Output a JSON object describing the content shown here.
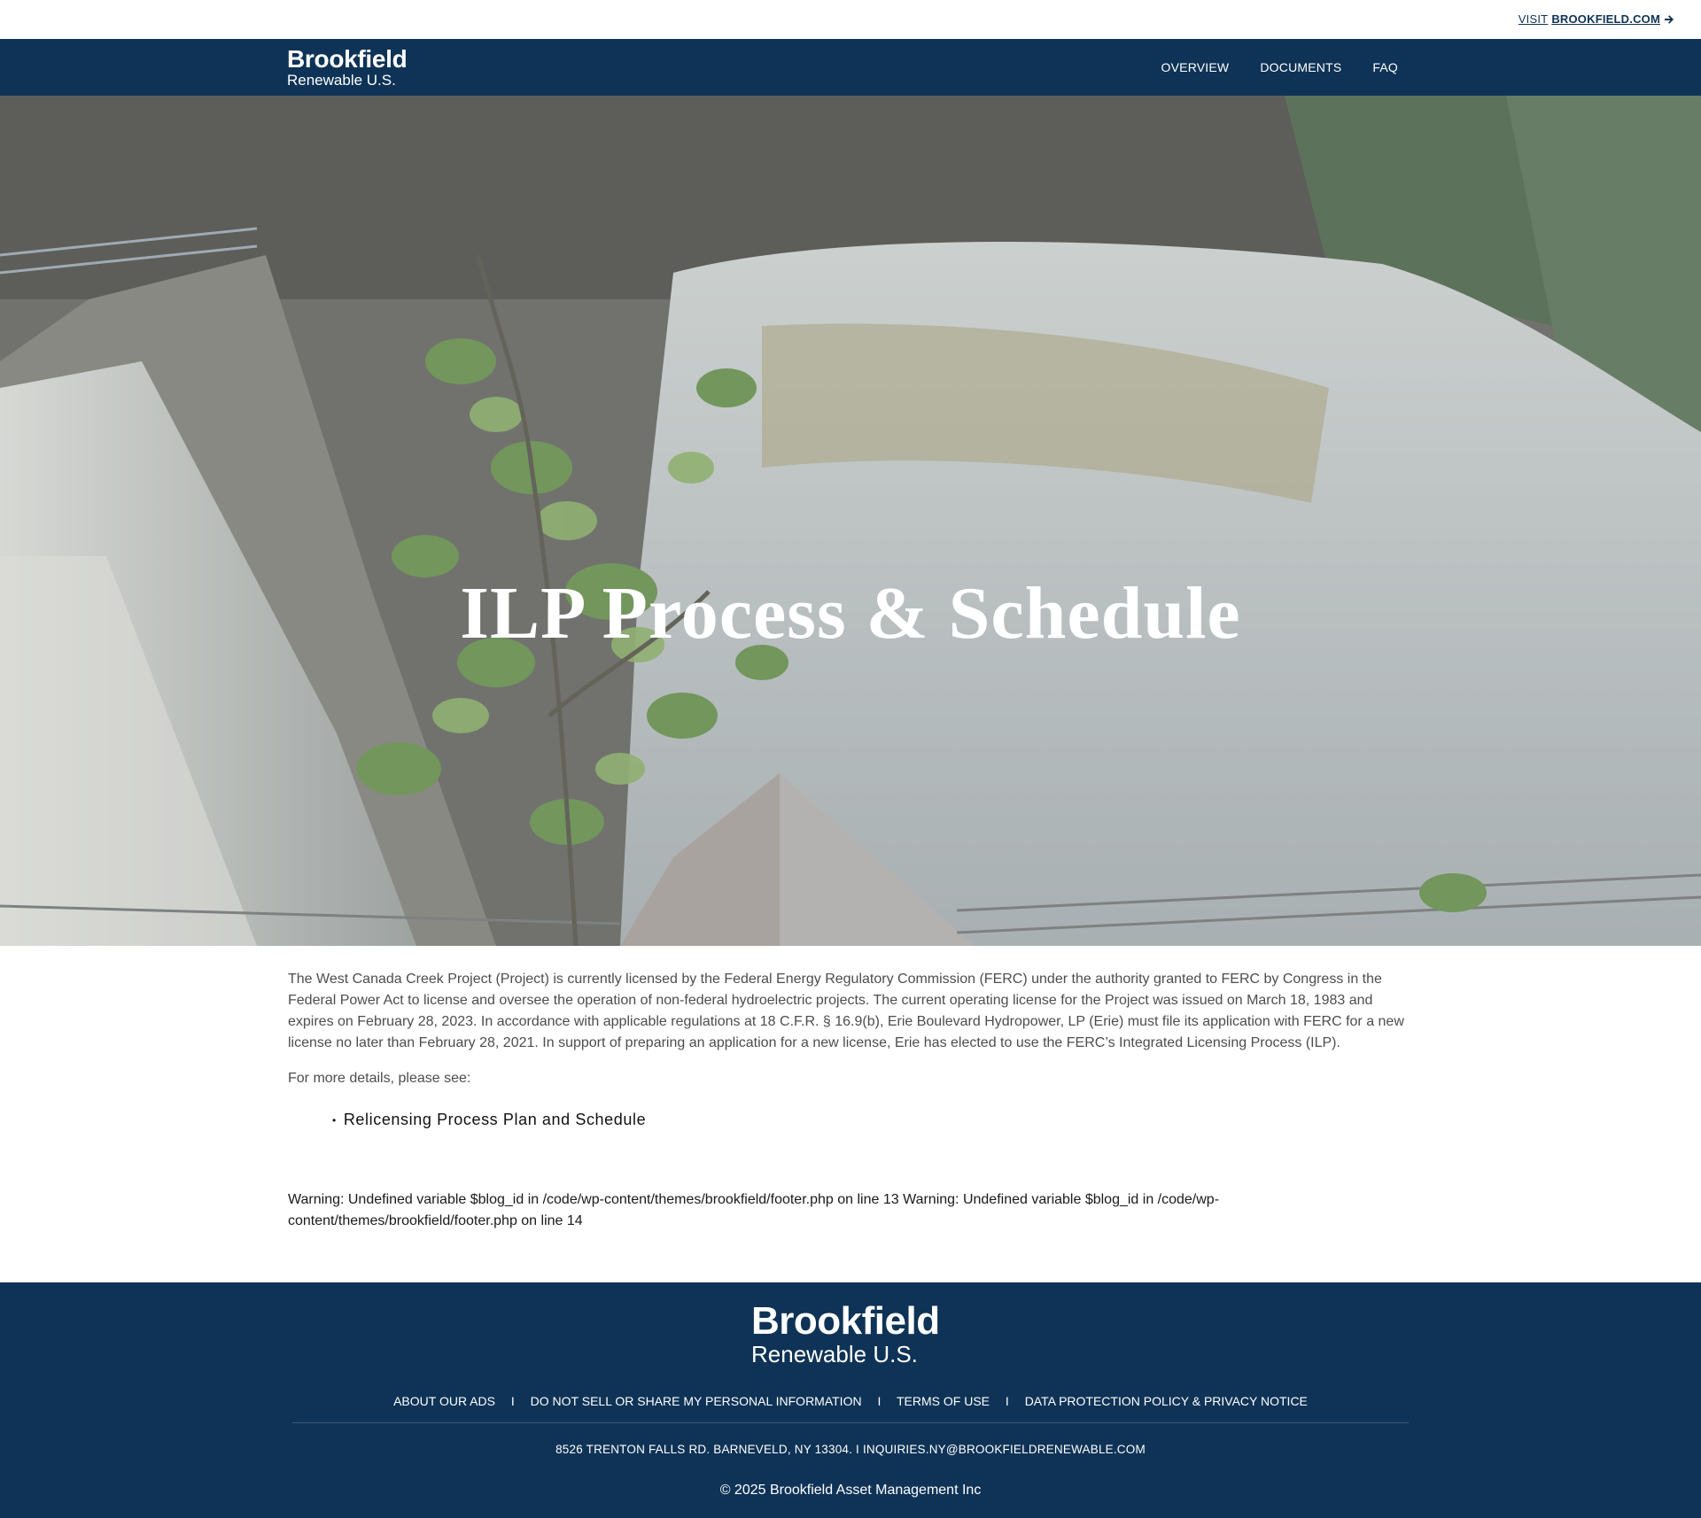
{
  "topbar": {
    "visit_prefix": "VISIT ",
    "visit_site": "BROOKFIELD.COM",
    "arrow_icon": "arrow-right-icon"
  },
  "header": {
    "logo_line1": "Brookfield",
    "logo_line2": "Renewable U.S.",
    "nav": [
      "OVERVIEW",
      "DOCUMENTS",
      "FAQ"
    ]
  },
  "hero": {
    "title": "ILP Process & Schedule"
  },
  "content": {
    "intro": "The West Canada Creek Project (Project) is currently licensed by the Federal Energy Regulatory Commission (FERC) under the authority granted to FERC by Congress in the Federal Power Act to license and oversee the operation of non-federal hydroelectric projects. The current operating license for the Project was issued on March 18, 1983 and expires on February 28, 2023. In accordance with applicable regulations at 18 C.F.R. § 16.9(b), Erie Boulevard Hydropower, LP (Erie) must file its application with FERC for a new license no later than February 28, 2021. In support of preparing an application for a new license, Erie has elected to use the FERC’s Integrated Licensing Process (ILP).",
    "more": "For more details, please see:",
    "links": [
      "Relicensing Process Plan and Schedule"
    ],
    "warning": "Warning: Undefined variable $blog_id in /code/wp-content/themes/brookfield/footer.php on line 13 Warning: Undefined variable $blog_id in /code/wp-content/themes/brookfield/footer.php on line 14"
  },
  "footer": {
    "logo_line1": "Brookfield",
    "logo_line2": "Renewable U.S.",
    "links": [
      "ABOUT OUR ADS",
      "DO NOT SELL OR SHARE MY PERSONAL INFORMATION",
      "TERMS OF USE",
      "DATA PROTECTION POLICY & PRIVACY NOTICE"
    ],
    "separator": "I",
    "address": "8526 TRENTON FALLS RD. BARNEVELD, NY 13304. I INQUIRIES.NY@BROOKFIELDRENEWABLE.COM",
    "copyright": "© 2025 Brookfield Asset Management Inc"
  },
  "colors": {
    "navy": "#0f3356",
    "text": "#4d4d4d"
  }
}
